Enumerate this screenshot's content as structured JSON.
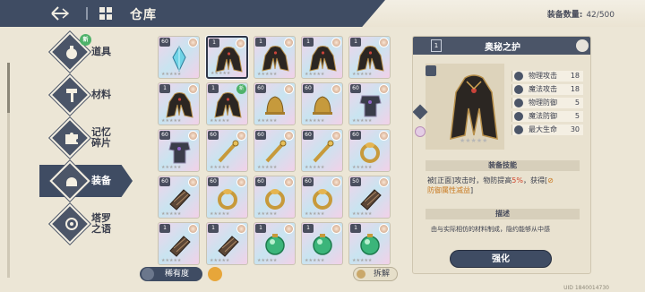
{
  "header": {
    "title": "仓库",
    "capacity_label": "装备数量:",
    "capacity_value": "42/500"
  },
  "nav": {
    "items": [
      {
        "label": "道具",
        "new": "新"
      },
      {
        "label": "材料"
      },
      {
        "label": "记忆\n碎片"
      },
      {
        "label": "装备",
        "active": true
      },
      {
        "label": "塔罗\n之语"
      }
    ]
  },
  "grid": {
    "rows": [
      [
        {
          "lvl": "60",
          "art": "crystal",
          "q": "pink"
        },
        {
          "lvl": "1",
          "art": "cloak",
          "q": "pink",
          "selected": true
        },
        {
          "lvl": "1",
          "art": "cloak",
          "q": "pink"
        },
        {
          "lvl": "1",
          "art": "cloak",
          "q": "pink"
        },
        {
          "lvl": "1",
          "art": "cloak",
          "q": "pink"
        }
      ],
      [
        {
          "lvl": "1",
          "art": "cloak",
          "q": "pink"
        },
        {
          "lvl": "1",
          "art": "cloak",
          "q": "pink",
          "new": "新"
        },
        {
          "lvl": "60",
          "art": "bell",
          "q": "pink"
        },
        {
          "lvl": "60",
          "art": "bell",
          "q": "pink"
        },
        {
          "lvl": "60",
          "art": "armor",
          "q": "pink"
        }
      ],
      [
        {
          "lvl": "60",
          "art": "armor",
          "q": "pink"
        },
        {
          "lvl": "60",
          "art": "staff",
          "q": "pink"
        },
        {
          "lvl": "60",
          "art": "staff",
          "q": "pink"
        },
        {
          "lvl": "60",
          "art": "staff",
          "q": "pink"
        },
        {
          "lvl": "60",
          "art": "ring",
          "q": "pink"
        }
      ],
      [
        {
          "lvl": "60",
          "art": "gauntlet",
          "q": "pink"
        },
        {
          "lvl": "60",
          "art": "ring",
          "q": "pink"
        },
        {
          "lvl": "60",
          "art": "ring",
          "q": "pink"
        },
        {
          "lvl": "60",
          "art": "ring",
          "q": "pink"
        },
        {
          "lvl": "50",
          "art": "gauntlet",
          "q": "pink"
        }
      ],
      [
        {
          "lvl": "1",
          "art": "gauntlet",
          "q": "pink"
        },
        {
          "lvl": "1",
          "art": "gauntlet",
          "q": "pink"
        },
        {
          "lvl": "1",
          "art": "orb",
          "q": "pink"
        },
        {
          "lvl": "1",
          "art": "orb",
          "q": "pink"
        },
        {
          "lvl": "1",
          "art": "orb",
          "q": "pink"
        }
      ]
    ]
  },
  "bottom": {
    "rarity_label": "稀有度",
    "decompose_label": "拆解"
  },
  "detail": {
    "count": "1",
    "name": "奥秘之护",
    "stats": [
      {
        "name": "物理攻击",
        "value": "18",
        "icon": "sword-icon"
      },
      {
        "name": "魔法攻击",
        "value": "18",
        "icon": "wand-icon"
      },
      {
        "name": "物理防御",
        "value": "5",
        "icon": "shield-icon"
      },
      {
        "name": "魔法防御",
        "value": "5",
        "icon": "magic-shield-icon"
      },
      {
        "name": "最大生命",
        "value": "30",
        "icon": "heart-icon"
      }
    ],
    "skill_title": "装备技能",
    "skill_p1": "被[正面]攻击时，物防提高",
    "skill_pct": "5%",
    "skill_p2": "，获得[",
    "skill_warn": "防御属性减益",
    "skill_p3": "]",
    "desc_title": "描述",
    "desc_text": "由与实际相仿的材料制成，隐约能够从中感",
    "enhance_label": "强化"
  },
  "uid": "UID 1840014730",
  "colors": {
    "accent": "#3f4c63",
    "highlight": "#d0442b",
    "warn": "#c97a21",
    "new": "#4fb26a"
  }
}
